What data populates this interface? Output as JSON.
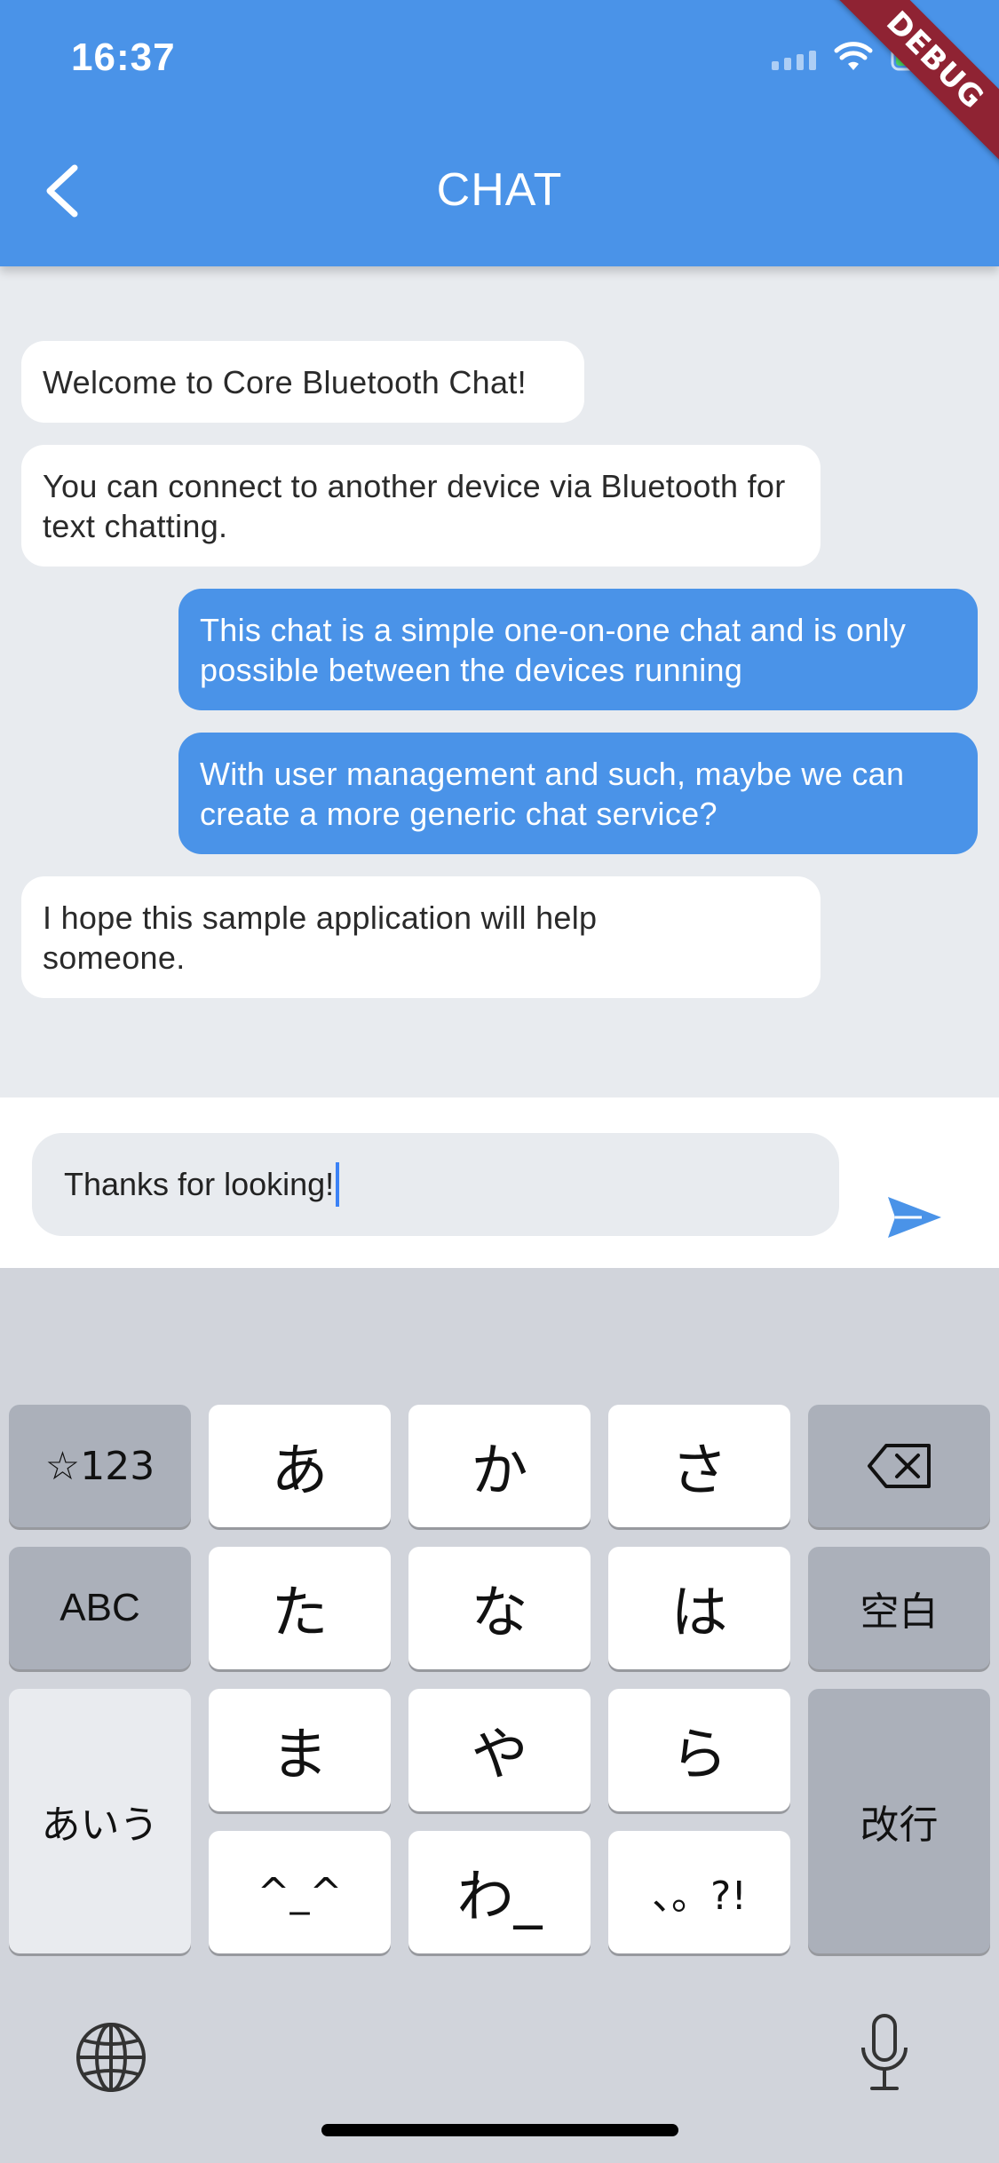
{
  "status_bar": {
    "time": "16:37"
  },
  "app_bar": {
    "title": "CHAT",
    "debug_banner": "DEBUG"
  },
  "messages": [
    {
      "direction": "in",
      "text": "Welcome to Core Bluetooth Chat!"
    },
    {
      "direction": "in",
      "text": "You can connect to another device via Bluetooth for text chatting."
    },
    {
      "direction": "out",
      "text": "This chat is a simple one-on-one chat and is only possible between the devices running"
    },
    {
      "direction": "out",
      "text": "With user management and such, maybe we can create a more generic chat service?"
    },
    {
      "direction": "in",
      "text": "I hope this sample application will help someone."
    }
  ],
  "composer": {
    "value": "Thanks for looking!"
  },
  "keyboard": {
    "keys": {
      "symbols": "☆123",
      "a": "あ",
      "ka": "か",
      "sa": "さ",
      "abc": "ABC",
      "ta": "た",
      "na": "な",
      "ha": "は",
      "space": "空白",
      "aiu": "あいう",
      "ma": "ま",
      "ya": "や",
      "ra": "ら",
      "return": "改行",
      "emoticon": "^_^",
      "wa": "わ_",
      "punct": "、。?!"
    }
  },
  "colors": {
    "accent": "#4a93e8",
    "background": "#e8ebef",
    "keyboard": "#d1d4db"
  }
}
